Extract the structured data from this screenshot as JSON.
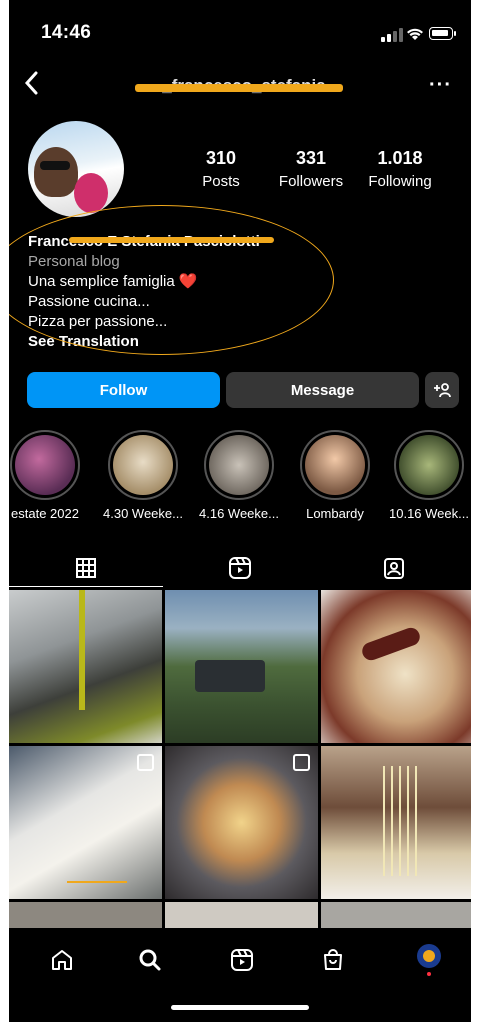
{
  "status_bar": {
    "time": "14:46"
  },
  "header": {
    "username": "_francesco_stefania",
    "more_label": "···"
  },
  "profile": {
    "stats": [
      {
        "value": "310",
        "label": "Posts"
      },
      {
        "value": "331",
        "label": "Followers"
      },
      {
        "value": "1.018",
        "label": "Following"
      }
    ],
    "name": "Francesco E Stefania Pasciolotti",
    "category": "Personal blog",
    "bio_lines": [
      "Una semplice famiglia ❤️",
      "Passione cucina...",
      "Pizza per passione..."
    ],
    "see_translation": "See Translation"
  },
  "actions": {
    "follow": "Follow",
    "message": "Message",
    "add_user": "+웃"
  },
  "highlights": [
    {
      "label": "estate 2022"
    },
    {
      "label": "4.30 Weeke..."
    },
    {
      "label": "4.16 Weeke..."
    },
    {
      "label": "Lombardy"
    },
    {
      "label": "10.16 Week..."
    }
  ],
  "tabs": [
    "grid-icon",
    "reels-icon",
    "tagged-icon"
  ],
  "posts": [
    {
      "subject": "olive oil pouring",
      "multi": false
    },
    {
      "subject": "tractor in olive grove",
      "multi": false
    },
    {
      "subject": "pasta with peppers",
      "multi": false
    },
    {
      "subject": "pizza dough",
      "multi": true
    },
    {
      "subject": "seafood pasta",
      "multi": true
    },
    {
      "subject": "spaghetti and wine",
      "multi": false
    }
  ],
  "nav": [
    "home-icon",
    "search-icon",
    "reels-icon",
    "shop-icon",
    "profile-avatar"
  ],
  "colors": {
    "accent": "#0095f6",
    "annotation": "#f0a81c",
    "background": "#000000"
  }
}
